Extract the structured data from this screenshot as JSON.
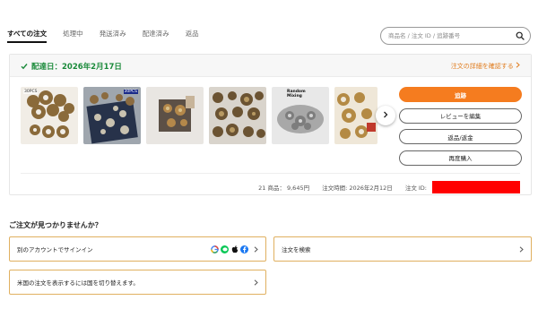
{
  "tabs": [
    {
      "label": "すべての注文",
      "active": true
    },
    {
      "label": "処理中",
      "active": false
    },
    {
      "label": "発送済み",
      "active": false
    },
    {
      "label": "配達済み",
      "active": false
    },
    {
      "label": "返品",
      "active": false
    }
  ],
  "search": {
    "placeholder": "商品名 / 注文 ID / 追跡番号",
    "icon": "search-icon"
  },
  "order": {
    "status": "配達日：2026年2月17日",
    "status_color": "#1a8a3a",
    "detail_link": "注文の詳細を確認する",
    "detail_link_color": "#e07b1c",
    "thumbnail_labels": [
      "30PCS",
      "30PCS",
      "Random Mixing"
    ],
    "actions": {
      "track": "追跡",
      "review": "レビューを編集",
      "return": "返品/返金",
      "rebuy": "再度購入"
    },
    "accent_color": "#f57c1f",
    "item_count": "21 商品：",
    "total": "9,645円",
    "order_time": "注文時間: 2026年2月12日",
    "order_id_label": "注文 ID:"
  },
  "help": {
    "title": "ご注文が見つかりませんか？",
    "sign_in_other": "別のアカウントでサインイン",
    "search_orders": "注文を検索",
    "switch_country": "米国の注文を表示するには国を切り替えます。",
    "login_icons": [
      "google-icon",
      "line-icon",
      "apple-icon",
      "facebook-icon"
    ]
  }
}
